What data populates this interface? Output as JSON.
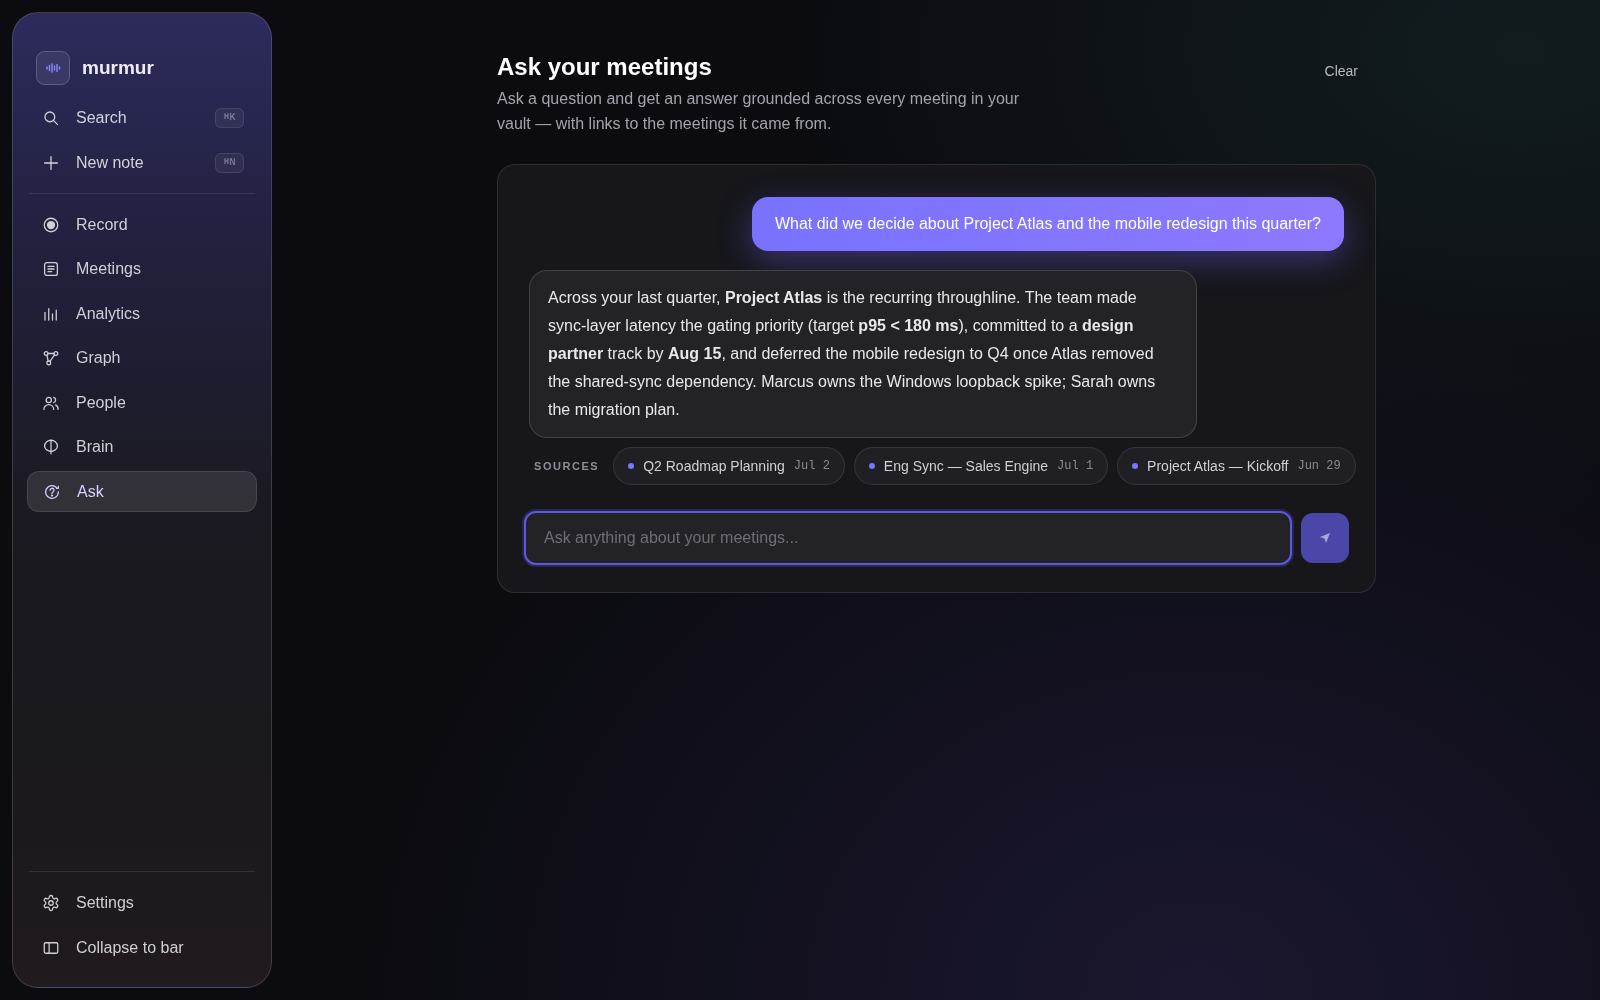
{
  "sidebar": {
    "brand": "murmur",
    "quick_actions": [
      {
        "label": "Search",
        "shortcut": "⌘K"
      },
      {
        "label": "New note",
        "shortcut": "⌘N"
      }
    ],
    "nav": [
      {
        "label": "Record",
        "selected": false
      },
      {
        "label": "Meetings",
        "selected": false
      },
      {
        "label": "Analytics",
        "selected": false
      },
      {
        "label": "Graph",
        "selected": false
      },
      {
        "label": "People",
        "selected": false
      },
      {
        "label": "Brain",
        "selected": false
      },
      {
        "label": "Ask",
        "selected": true
      }
    ],
    "footer": [
      {
        "label": "Settings"
      },
      {
        "label": "Collapse to bar"
      }
    ]
  },
  "header": {
    "title": "Ask your meetings",
    "subtitle": "Ask a question and get an answer grounded across every meeting in your vault — with links to the meetings it came from.",
    "clear_button": "Clear"
  },
  "chat": {
    "messages": [
      {
        "kind": "user",
        "text": "What did we decide about Project Atlas and the mobile redesign this quarter?"
      },
      {
        "kind": "assistant",
        "text": "Across your last quarter, **Project Atlas** is the recurring throughline. The team made sync-layer latency the gating priority (target **p95 < 180 ms**), committed to a **design partner** track by **Aug 15**, and deferred the mobile redesign to Q4 once Atlas removed the shared-sync dependency. Marcus owns the Windows loopback spike; Sarah owns the migration plan."
      }
    ],
    "sources_label": "SOURCES",
    "sources": [
      {
        "title": "Q2 Roadmap Planning",
        "date": "Jul 2"
      },
      {
        "title": "Eng Sync — Sales Engine",
        "date": "Jul 1"
      },
      {
        "title": "Project Atlas — Kickoff",
        "date": "Jun 29"
      }
    ],
    "input": {
      "placeholder": "Ask anything about your meetings..."
    }
  }
}
